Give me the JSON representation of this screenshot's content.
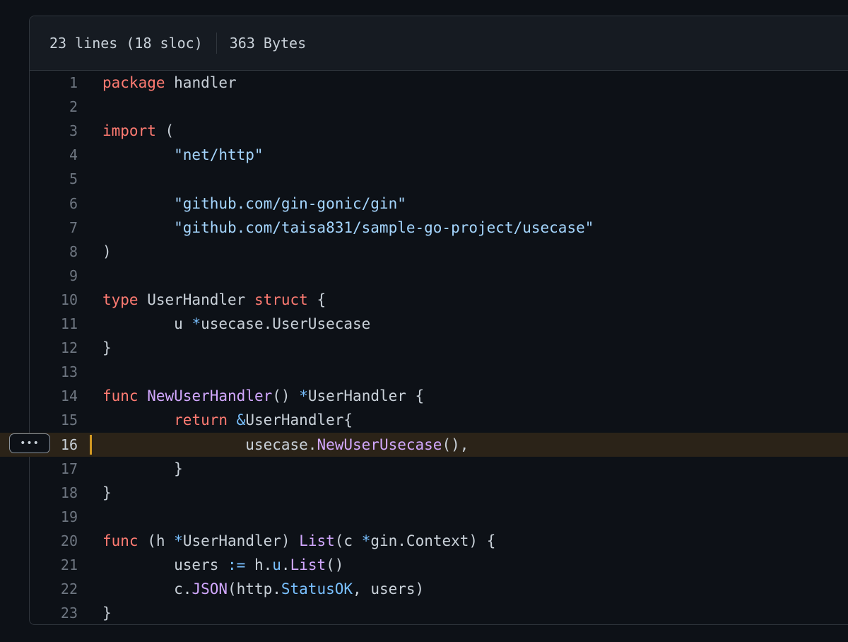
{
  "file_header": {
    "lines_info": "23 lines (18 sloc)",
    "size": "363 Bytes"
  },
  "line_actions": {
    "menu_label": "•••"
  },
  "highlighted_line": 16,
  "colors": {
    "keyword": "#ff7b72",
    "string": "#a5d6ff",
    "function": "#d2a8ff",
    "operator": "#79c0ff",
    "plain": "#c9d1d9",
    "highlight_bg": "#2b2318",
    "highlight_bar": "#d29922"
  },
  "code": [
    {
      "num": "1",
      "tokens": [
        {
          "t": "package",
          "c": "k"
        },
        {
          "t": " handler",
          "c": "n"
        }
      ]
    },
    {
      "num": "2",
      "tokens": []
    },
    {
      "num": "3",
      "tokens": [
        {
          "t": "import",
          "c": "k"
        },
        {
          "t": " (",
          "c": "n"
        }
      ]
    },
    {
      "num": "4",
      "tokens": [
        {
          "t": "\t\"net/http\"",
          "c": "s"
        }
      ]
    },
    {
      "num": "5",
      "tokens": []
    },
    {
      "num": "6",
      "tokens": [
        {
          "t": "\t\"github.com/gin-gonic/gin\"",
          "c": "s"
        }
      ]
    },
    {
      "num": "7",
      "tokens": [
        {
          "t": "\t\"github.com/taisa831/sample-go-project/usecase\"",
          "c": "s"
        }
      ]
    },
    {
      "num": "8",
      "tokens": [
        {
          "t": ")",
          "c": "n"
        }
      ]
    },
    {
      "num": "9",
      "tokens": []
    },
    {
      "num": "10",
      "tokens": [
        {
          "t": "type",
          "c": "k"
        },
        {
          "t": " UserHandler ",
          "c": "n"
        },
        {
          "t": "struct",
          "c": "k"
        },
        {
          "t": " {",
          "c": "n"
        }
      ]
    },
    {
      "num": "11",
      "tokens": [
        {
          "t": "\tu ",
          "c": "n"
        },
        {
          "t": "*",
          "c": "o"
        },
        {
          "t": "usecase.UserUsecase",
          "c": "n"
        }
      ]
    },
    {
      "num": "12",
      "tokens": [
        {
          "t": "}",
          "c": "n"
        }
      ]
    },
    {
      "num": "13",
      "tokens": []
    },
    {
      "num": "14",
      "tokens": [
        {
          "t": "func",
          "c": "k"
        },
        {
          "t": " ",
          "c": "n"
        },
        {
          "t": "NewUserHandler",
          "c": "f"
        },
        {
          "t": "() ",
          "c": "n"
        },
        {
          "t": "*",
          "c": "o"
        },
        {
          "t": "UserHandler {",
          "c": "n"
        }
      ]
    },
    {
      "num": "15",
      "tokens": [
        {
          "t": "\t",
          "c": "n"
        },
        {
          "t": "return",
          "c": "k"
        },
        {
          "t": " ",
          "c": "n"
        },
        {
          "t": "&",
          "c": "o"
        },
        {
          "t": "UserHandler{",
          "c": "n"
        }
      ]
    },
    {
      "num": "16",
      "tokens": [
        {
          "t": "\t\tusecase.",
          "c": "n"
        },
        {
          "t": "NewUserUsecase",
          "c": "f"
        },
        {
          "t": "(),",
          "c": "n"
        }
      ]
    },
    {
      "num": "17",
      "tokens": [
        {
          "t": "\t}",
          "c": "n"
        }
      ]
    },
    {
      "num": "18",
      "tokens": [
        {
          "t": "}",
          "c": "n"
        }
      ]
    },
    {
      "num": "19",
      "tokens": []
    },
    {
      "num": "20",
      "tokens": [
        {
          "t": "func",
          "c": "k"
        },
        {
          "t": " (h ",
          "c": "n"
        },
        {
          "t": "*",
          "c": "o"
        },
        {
          "t": "UserHandler) ",
          "c": "n"
        },
        {
          "t": "List",
          "c": "f"
        },
        {
          "t": "(c ",
          "c": "n"
        },
        {
          "t": "*",
          "c": "o"
        },
        {
          "t": "gin.Context) {",
          "c": "n"
        }
      ]
    },
    {
      "num": "21",
      "tokens": [
        {
          "t": "\tusers ",
          "c": "n"
        },
        {
          "t": ":=",
          "c": "o"
        },
        {
          "t": " h.",
          "c": "n"
        },
        {
          "t": "u",
          "c": "o"
        },
        {
          "t": ".",
          "c": "n"
        },
        {
          "t": "List",
          "c": "f"
        },
        {
          "t": "()",
          "c": "n"
        }
      ]
    },
    {
      "num": "22",
      "tokens": [
        {
          "t": "\tc.",
          "c": "n"
        },
        {
          "t": "JSON",
          "c": "f"
        },
        {
          "t": "(http.",
          "c": "n"
        },
        {
          "t": "StatusOK",
          "c": "o"
        },
        {
          "t": ", users)",
          "c": "n"
        }
      ]
    },
    {
      "num": "23",
      "tokens": [
        {
          "t": "}",
          "c": "n"
        }
      ]
    }
  ]
}
